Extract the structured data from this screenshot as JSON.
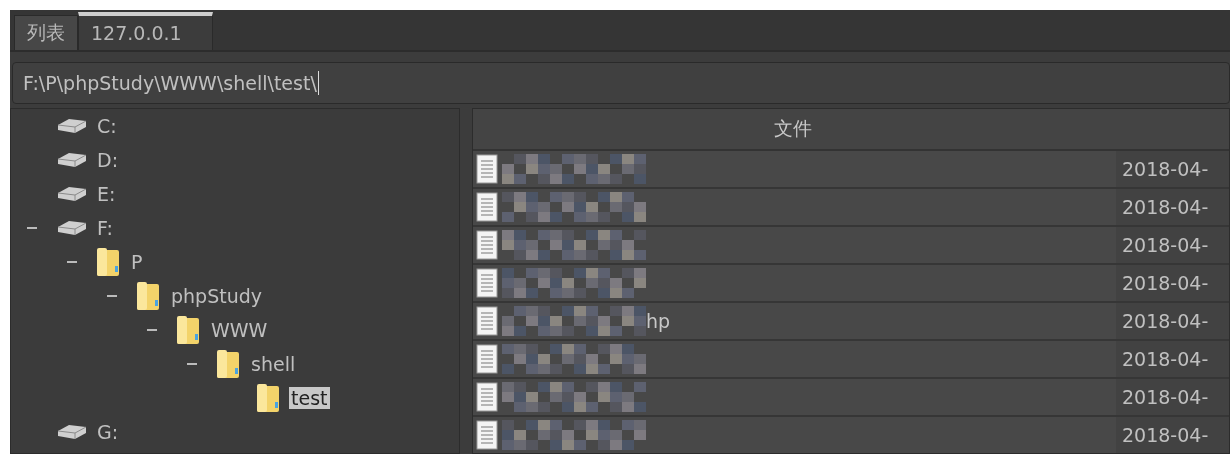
{
  "tabs": [
    {
      "label": "列表",
      "selected": false
    },
    {
      "label": "127.0.0.1",
      "selected": true
    }
  ],
  "address_bar": {
    "value": "F:\\P\\phpStudy\\WWW\\shell\\test\\"
  },
  "tree": [
    {
      "kind": "drive",
      "label": "C:",
      "expanded": false,
      "selected": false
    },
    {
      "kind": "drive",
      "label": "D:",
      "expanded": false,
      "selected": false
    },
    {
      "kind": "drive",
      "label": "E:",
      "expanded": false,
      "selected": false
    },
    {
      "kind": "drive",
      "label": "F:",
      "expanded": true,
      "selected": false,
      "children": [
        {
          "kind": "folder",
          "label": "P",
          "expanded": true,
          "selected": false,
          "children": [
            {
              "kind": "folder",
              "label": "phpStudy",
              "expanded": true,
              "selected": false,
              "children": [
                {
                  "kind": "folder",
                  "label": "WWW",
                  "expanded": true,
                  "selected": false,
                  "children": [
                    {
                      "kind": "folder",
                      "label": "shell",
                      "expanded": true,
                      "selected": false,
                      "children": [
                        {
                          "kind": "folder",
                          "label": "test",
                          "expanded": false,
                          "selected": true
                        }
                      ]
                    }
                  ]
                }
              ]
            }
          ]
        }
      ]
    },
    {
      "kind": "drive",
      "label": "G:",
      "expanded": false,
      "selected": false
    }
  ],
  "table": {
    "columns": [
      "文件"
    ],
    "rows": [
      {
        "date": "2018-04-"
      },
      {
        "date": "2018-04-"
      },
      {
        "date": "2018-04-"
      },
      {
        "date": "2018-04-"
      },
      {
        "name_tail": "hp",
        "date": "2018-04-"
      },
      {
        "date": "2018-04-"
      },
      {
        "date": "2018-04-"
      },
      {
        "date": "2018-04-"
      }
    ]
  }
}
